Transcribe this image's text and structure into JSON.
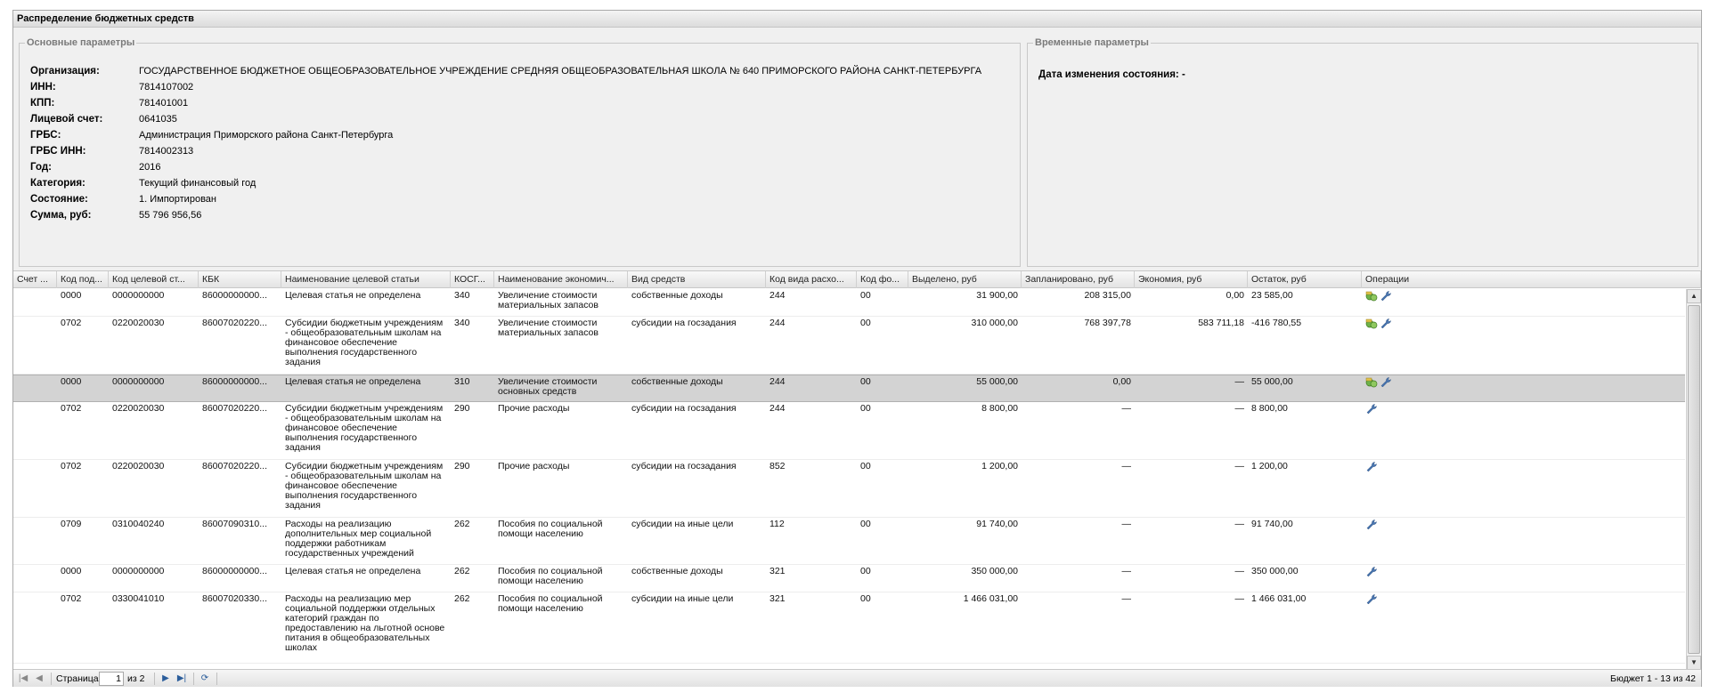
{
  "window": {
    "title": "Распределение бюджетных средств"
  },
  "main_params": {
    "legend": "Основные параметры",
    "rows": [
      {
        "label": "Организация:",
        "value": "ГОСУДАРСТВЕННОЕ БЮДЖЕТНОЕ ОБЩЕОБРАЗОВАТЕЛЬНОЕ УЧРЕЖДЕНИЕ СРЕДНЯЯ ОБЩЕОБРАЗОВАТЕЛЬНАЯ ШКОЛА № 640 ПРИМОРСКОГО РАЙОНА САНКТ-ПЕТЕРБУРГА"
      },
      {
        "label": "ИНН:",
        "value": "7814107002"
      },
      {
        "label": "КПП:",
        "value": "781401001"
      },
      {
        "label": "Лицевой счет:",
        "value": "0641035"
      },
      {
        "label": "ГРБС:",
        "value": "Администрация Приморского района Санкт-Петербурга"
      },
      {
        "label": "ГРБС ИНН:",
        "value": "7814002313"
      },
      {
        "label": "Год:",
        "value": "2016"
      },
      {
        "label": "Категория:",
        "value": "Текущий финансовый год"
      },
      {
        "label": "Состояние:",
        "value": "1. Импортирован"
      },
      {
        "label": "Сумма, руб:",
        "value": "55 796 956,56"
      }
    ]
  },
  "time_params": {
    "legend": "Временные параметры",
    "state_change_label": "Дата изменения состояния:",
    "state_change_value": "-"
  },
  "grid": {
    "columns": [
      "Счет ...",
      "Код под...",
      "Код целевой ст...",
      "КБК",
      "Наименование целевой статьи",
      "КОСГ...",
      "Наименование экономич...",
      "Вид средств",
      "Код вида расхо...",
      "Код фо...",
      "Выделено, руб",
      "Запланировано, руб",
      "Экономия, руб",
      "Остаток, руб",
      "Операции"
    ],
    "rows": [
      {
        "account": "",
        "sub": "0000",
        "target": "0000000000",
        "kbk": "86000000000...",
        "name": "Целевая статья не определена",
        "kosgu": "340",
        "econ": "Увеличение стоимости материальных запасов",
        "funds": "собственные доходы",
        "exp": "244",
        "fo": "00",
        "allocated": "31 900,00",
        "planned": "208 315,00",
        "economy": "0,00",
        "rest": "23 585,00",
        "ops": [
          "money-icon",
          "wrench-icon"
        ]
      },
      {
        "account": "",
        "sub": "0702",
        "target": "0220020030",
        "kbk": "86007020220...",
        "name": "Субсидии бюджетным учреждениям - общеобразовательным школам на финансовое обеспечение выполнения государственного задания",
        "kosgu": "340",
        "econ": "Увеличение стоимости материальных запасов",
        "funds": "субсидии на госзадания",
        "exp": "244",
        "fo": "00",
        "allocated": "310 000,00",
        "planned": "768 397,78",
        "economy": "583 711,18",
        "rest": "-416 780,55",
        "ops": [
          "money-icon",
          "wrench-icon"
        ]
      },
      {
        "account": "",
        "sub": "0000",
        "target": "0000000000",
        "kbk": "86000000000...",
        "name": "Целевая статья не определена",
        "kosgu": "310",
        "econ": "Увеличение стоимости основных средств",
        "funds": "собственные доходы",
        "exp": "244",
        "fo": "00",
        "allocated": "55 000,00",
        "planned": "0,00",
        "economy": "—",
        "rest": "55 000,00",
        "ops": [
          "money-icon",
          "wrench-icon"
        ]
      },
      {
        "account": "",
        "sub": "0702",
        "target": "0220020030",
        "kbk": "86007020220...",
        "name": "Субсидии бюджетным учреждениям - общеобразовательным школам на финансовое обеспечение выполнения государственного задания",
        "kosgu": "290",
        "econ": "Прочие расходы",
        "funds": "субсидии на госзадания",
        "exp": "244",
        "fo": "00",
        "allocated": "8 800,00",
        "planned": "—",
        "economy": "—",
        "rest": "8 800,00",
        "ops": [
          "wrench-icon"
        ]
      },
      {
        "account": "",
        "sub": "0702",
        "target": "0220020030",
        "kbk": "86007020220...",
        "name": "Субсидии бюджетным учреждениям - общеобразовательным школам на финансовое обеспечение выполнения государственного задания",
        "kosgu": "290",
        "econ": "Прочие расходы",
        "funds": "субсидии на госзадания",
        "exp": "852",
        "fo": "00",
        "allocated": "1 200,00",
        "planned": "—",
        "economy": "—",
        "rest": "1 200,00",
        "ops": [
          "wrench-icon"
        ]
      },
      {
        "account": "",
        "sub": "0709",
        "target": "0310040240",
        "kbk": "86007090310...",
        "name": "Расходы на реализацию дополнительных мер социальной поддержки работникам государственных учреждений",
        "kosgu": "262",
        "econ": "Пособия по социальной помощи населению",
        "funds": "субсидии на иные цели",
        "exp": "112",
        "fo": "00",
        "allocated": "91 740,00",
        "planned": "—",
        "economy": "—",
        "rest": "91 740,00",
        "ops": [
          "wrench-icon"
        ]
      },
      {
        "account": "",
        "sub": "0000",
        "target": "0000000000",
        "kbk": "86000000000...",
        "name": "Целевая статья не определена",
        "kosgu": "262",
        "econ": "Пособия по социальной помощи населению",
        "funds": "собственные доходы",
        "exp": "321",
        "fo": "00",
        "allocated": "350 000,00",
        "planned": "—",
        "economy": "—",
        "rest": "350 000,00",
        "ops": [
          "wrench-icon"
        ]
      },
      {
        "account": "",
        "sub": "0702",
        "target": "0330041010",
        "kbk": "86007020330...",
        "name": "Расходы на реализацию мер социальной поддержки отдельных категорий граждан по предоставлению на льготной основе питания в общеобразовательных школах",
        "kosgu": "262",
        "econ": "Пособия по социальной помощи населению",
        "funds": "субсидии на иные цели",
        "exp": "321",
        "fo": "00",
        "allocated": "1 466 031,00",
        "planned": "—",
        "economy": "—",
        "rest": "1 466 031,00",
        "ops": [
          "wrench-icon"
        ]
      }
    ]
  },
  "pager": {
    "page_label": "Страница",
    "page_value": "1",
    "of_label": "из 2",
    "info": "Бюджет 1 - 13 из 42"
  }
}
